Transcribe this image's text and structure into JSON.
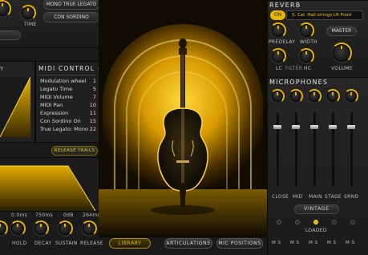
{
  "articulation_buttons": {
    "mono_true_legato": "MONO TRUE LEGATO",
    "con_sordino": "CON SORDINO"
  },
  "time_knob_label": "TIME",
  "midi_control": {
    "title": "MIDI CONTROL #",
    "rows": [
      {
        "name": "Modulation wheel",
        "cc": "1"
      },
      {
        "name": "Legato Time",
        "cc": "5"
      },
      {
        "name": "MIDI Volume",
        "cc": "7"
      },
      {
        "name": "MIDI Pan",
        "cc": "10"
      },
      {
        "name": "Expression",
        "cc": "11"
      },
      {
        "name": "Con Sordino On",
        "cc": "15"
      },
      {
        "name": "True Legato: Mono",
        "cc": "22"
      }
    ]
  },
  "release_trails_label": "RELEASE TRAILS",
  "envelope": {
    "values": {
      "time_val": "0.0ms",
      "decay_val": "750ms",
      "sustain_val": "0dB",
      "release_val": "264ms"
    },
    "labels": {
      "hold": "HOLD",
      "decay": "DECAY",
      "sustain": "SUSTAIN",
      "release": "RELEASE"
    }
  },
  "bottom_tabs": {
    "library": "LIBRARY",
    "articulations": "ARTICULATIONS",
    "mic_positions": "MIC POSITIONS"
  },
  "reverb": {
    "title": "REVERB",
    "toggle": "ON",
    "preset": "S. Cal. Hall strings LR Front",
    "labels": {
      "predelay": "PREDELAY",
      "width": "WIDTH",
      "master": "MASTER",
      "lc": "LC",
      "filter": "FILTER",
      "hc": "HC",
      "volume": "VOLUME"
    }
  },
  "microphones": {
    "title": "MICROPHONES",
    "channels": [
      "CLOSE",
      "MID",
      "MAIN",
      "STAGE",
      "SRND"
    ],
    "preset_button": "VINTAGE",
    "loaded_label": "LOADED",
    "ms_label": "M S"
  },
  "colors": {
    "accent": "#e7b400",
    "panel": "#222222",
    "background": "#121212"
  }
}
